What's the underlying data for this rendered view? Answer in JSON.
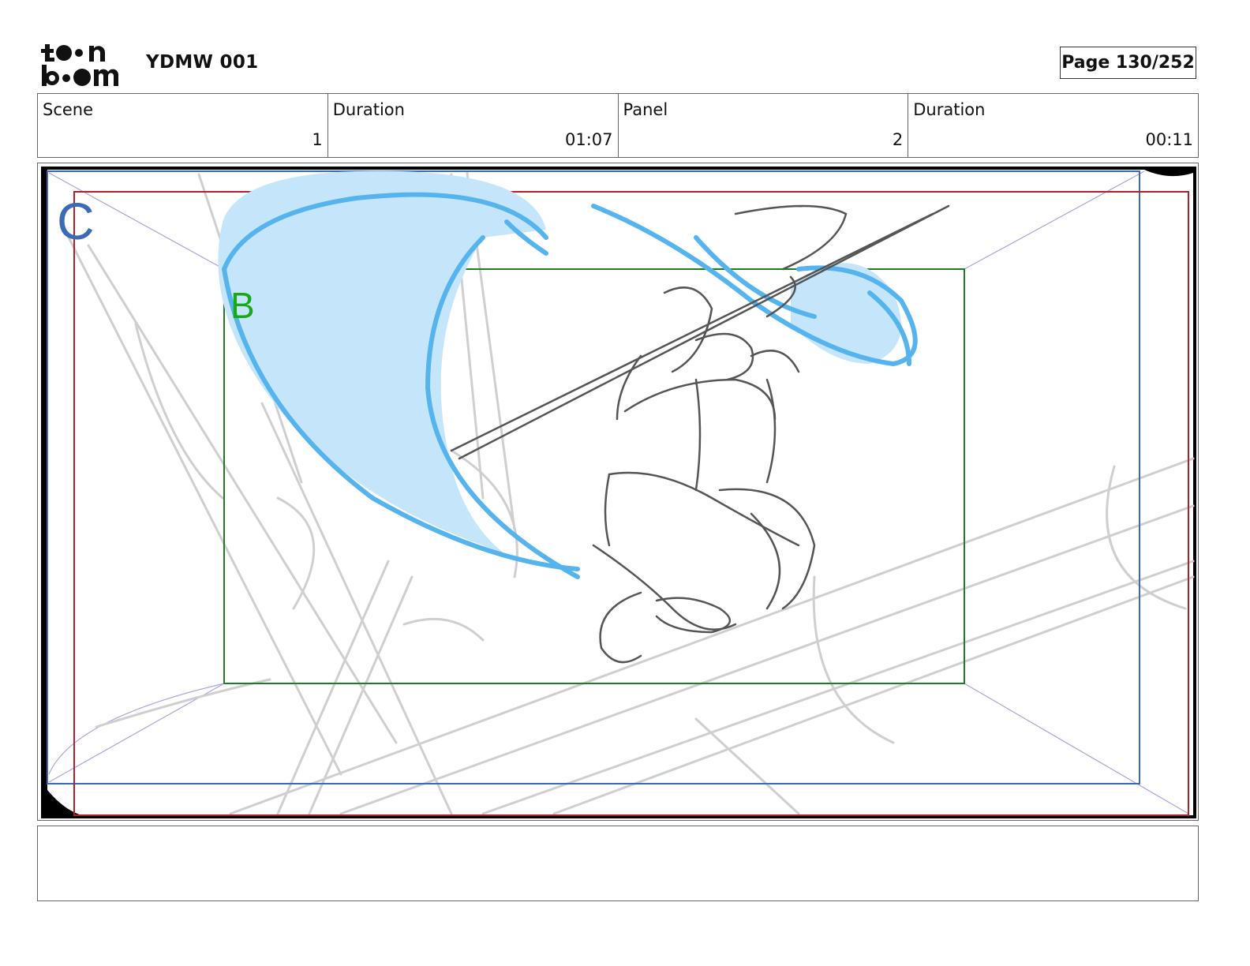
{
  "header": {
    "project_title": "YDMW 001",
    "page_label": "Page 130/252",
    "logo": "toon boom"
  },
  "info": {
    "scene_label": "Scene",
    "scene_value": "1",
    "scene_duration_label": "Duration",
    "scene_duration_value": "01:07",
    "panel_label": "Panel",
    "panel_value": "2",
    "panel_duration_label": "Duration",
    "panel_duration_value": "00:11"
  },
  "panel": {
    "camera_label_c": "C",
    "camera_label_b": "B",
    "colors": {
      "frame_c": "#3b6bb5",
      "frame_red": "#b0202a",
      "frame_b": "#1e7d1e",
      "water_fill": "#c5e6fa",
      "water_stroke": "#55b4ee",
      "sketch_dark": "#555555",
      "sketch_light": "#cccccc"
    }
  },
  "notes": {
    "text": ""
  }
}
